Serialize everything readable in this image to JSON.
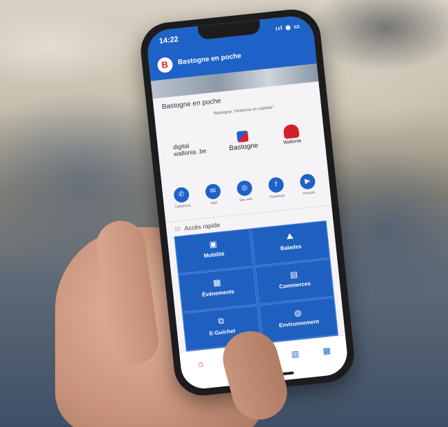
{
  "status": {
    "time": "14:22",
    "icons": "ııl ◉ ▭"
  },
  "app": {
    "title": "Bastogne en poche"
  },
  "content": {
    "title": "Bastogne en poche",
    "subtitle": "\"Bastogne, l'Ardenne en capitale\"",
    "partners": {
      "digital": "digital wallonia .be",
      "bastogne": "Bastogne",
      "wallonie": "Wallonie"
    }
  },
  "contacts": [
    {
      "label": "Téléphone",
      "icon": "phone-icon",
      "glyph": "✆"
    },
    {
      "label": "Mail",
      "icon": "mail-icon",
      "glyph": "✉"
    },
    {
      "label": "Site web",
      "icon": "globe-icon",
      "glyph": "◎"
    },
    {
      "label": "Facebook",
      "icon": "facebook-icon",
      "glyph": "f"
    },
    {
      "label": "Youtube",
      "icon": "youtube-icon",
      "glyph": "▶"
    }
  ],
  "quick_access": {
    "label": "Accès rapide"
  },
  "tiles": [
    {
      "label": "Mobilité",
      "icon": "bus-icon",
      "glyph": "▣"
    },
    {
      "label": "Balades",
      "icon": "hiker-icon",
      "glyph": "⛰"
    },
    {
      "label": "Événements",
      "icon": "calendar-icon",
      "glyph": "▦"
    },
    {
      "label": "Commerces",
      "icon": "shop-icon",
      "glyph": "▤"
    },
    {
      "label": "E-Guichet",
      "icon": "documents-icon",
      "glyph": "⧉"
    },
    {
      "label": "Environnement",
      "icon": "globe-icon",
      "glyph": "◍"
    }
  ],
  "bottom_nav": [
    {
      "icon": "home-icon",
      "glyph": "⌂"
    },
    {
      "icon": "heart-icon",
      "glyph": "♥"
    },
    {
      "icon": "search-icon",
      "glyph": "⌕"
    },
    {
      "icon": "map-icon",
      "glyph": "▥"
    },
    {
      "icon": "grid-icon",
      "glyph": "▦"
    }
  ],
  "colors": {
    "primary": "#1e62c8",
    "accent_red": "#e11d2a"
  }
}
